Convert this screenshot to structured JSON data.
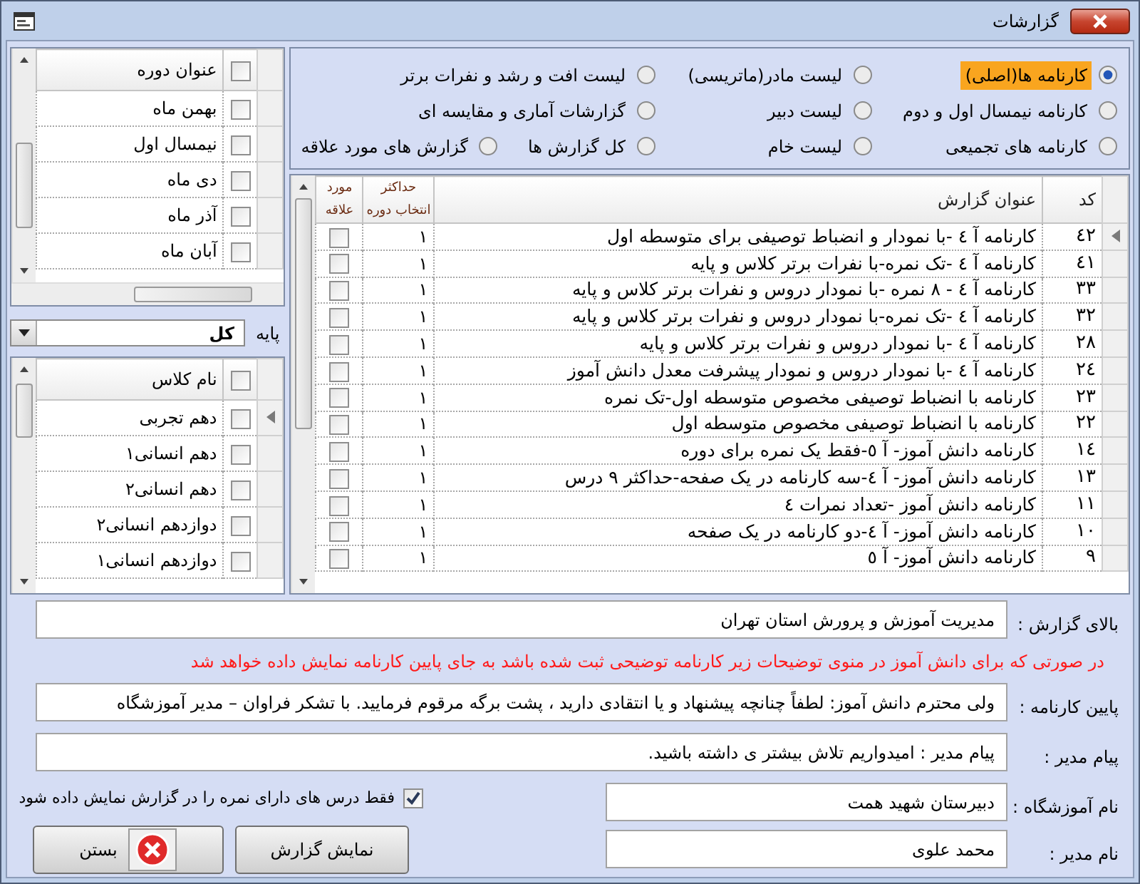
{
  "window": {
    "title": "گزارشات"
  },
  "report_type_rows": [
    {
      "options": [
        {
          "label": "کارنامه ها(اصلی)",
          "selected": true
        },
        {
          "label": "لیست مادر(ماتریسی)",
          "selected": false
        },
        {
          "label": "لیست افت و رشد و نفرات برتر",
          "selected": false
        }
      ]
    },
    {
      "options": [
        {
          "label": "کارنامه نیمسال اول و دوم",
          "selected": false
        },
        {
          "label": "لیست دبیر",
          "selected": false
        },
        {
          "label": "گزارشات آماری و مقایسه ای",
          "selected": false
        }
      ]
    },
    {
      "options": [
        {
          "label": "کارنامه های تجمیعی",
          "selected": false
        },
        {
          "label": "لیست خام",
          "selected": false
        },
        {
          "label": "کل گزارش ها",
          "selected": false
        },
        {
          "label": "گزارش های مورد علاقه",
          "selected": false
        }
      ]
    }
  ],
  "reports": {
    "columns": [
      "کد",
      "عنوان گزارش",
      "حداکثر انتخاب دوره",
      "مورد علاقه"
    ],
    "rows": [
      {
        "code": "٤٢",
        "title": "کارنامه آ ٤ -با نمودار و انضباط توصیفی برای متوسطه اول",
        "max": "١",
        "favorite": false,
        "current": true
      },
      {
        "code": "٤١",
        "title": "کارنامه آ ٤ -تک نمره-با نفرات برتر کلاس و پایه",
        "max": "١",
        "favorite": false,
        "current": false
      },
      {
        "code": "٣٣",
        "title": "کارنامه آ ٤ - ٨  نمره  -با نمودار دروس و نفرات برتر کلاس و پایه",
        "max": "١",
        "favorite": false,
        "current": false
      },
      {
        "code": "٣٢",
        "title": "کارنامه آ ٤ -تک نمره-با نمودار دروس و نفرات برتر کلاس و پایه",
        "max": "١",
        "favorite": false,
        "current": false
      },
      {
        "code": "٢٨",
        "title": "کارنامه آ ٤ -با نمودار دروس و نفرات برتر کلاس و پایه",
        "max": "١",
        "favorite": false,
        "current": false
      },
      {
        "code": "٢٤",
        "title": "کارنامه آ ٤ -با نمودار دروس و نمودار پیشرفت معدل دانش آموز",
        "max": "١",
        "favorite": false,
        "current": false
      },
      {
        "code": "٢٣",
        "title": "کارنامه با انضباط توصیفی مخصوص متوسطه اول-تک نمره",
        "max": "١",
        "favorite": false,
        "current": false
      },
      {
        "code": "٢٢",
        "title": "کارنامه با انضباط توصیفی مخصوص متوسطه اول",
        "max": "١",
        "favorite": false,
        "current": false
      },
      {
        "code": "١٤",
        "title": "کارنامه دانش آموز- آ ٥-فقط یک نمره برای دوره",
        "max": "١",
        "favorite": false,
        "current": false
      },
      {
        "code": "١٣",
        "title": "کارنامه دانش آموز- آ ٤-سه کارنامه در یک صفحه-حداکثر ٩ درس",
        "max": "١",
        "favorite": false,
        "current": false
      },
      {
        "code": "١١",
        "title": "کارنامه دانش آموز -تعداد نمرات ٤",
        "max": "١",
        "favorite": false,
        "current": false
      },
      {
        "code": "١٠",
        "title": "کارنامه دانش آموز- آ ٤-دو کارنامه در یک صفحه",
        "max": "١",
        "favorite": false,
        "current": false
      },
      {
        "code": "٩",
        "title": "کارنامه دانش آموز- آ ٥",
        "max": "١",
        "favorite": false,
        "current": false
      }
    ]
  },
  "periods": {
    "header": "عنوان دوره",
    "header_checked": false,
    "rows": [
      {
        "label": "بهمن ماه",
        "checked": false,
        "current": false
      },
      {
        "label": "نیمسال  اول",
        "checked": false,
        "current": false
      },
      {
        "label": "دی ماه",
        "checked": false,
        "current": false
      },
      {
        "label": "آذر ماه",
        "checked": false,
        "current": false
      },
      {
        "label": "آبان ماه",
        "checked": false,
        "current": false
      }
    ]
  },
  "grade": {
    "label": "پایه",
    "value": "کل"
  },
  "classes": {
    "header": "نام کلاس",
    "header_checked": false,
    "rows": [
      {
        "label": "دهم تجربی",
        "checked": false,
        "current": true
      },
      {
        "label": "دهم انسانی۱",
        "checked": false,
        "current": false
      },
      {
        "label": "دهم انسانی۲",
        "checked": false,
        "current": false
      },
      {
        "label": "دوازدهم انسانی۲",
        "checked": false,
        "current": false
      },
      {
        "label": "دوازدهم انسانی۱",
        "checked": false,
        "current": false
      }
    ]
  },
  "report_header": {
    "label": "بالای گزارش :",
    "value": "مدیریت آموزش و پرورش استان تهران"
  },
  "note": "در صورتی که برای دانش آموز در منوی توضیحات زیر کارنامه توضیحی ثبت شده باشد به جای پایین کارنامه نمایش داده خواهد شد",
  "report_footer": {
    "label": "پایین کارنامه :",
    "value": "ولی محترم دانش آموز: لطفاً چنانچه پیشنهاد و یا انتقادی دارید ، پشت برگه مرقوم فرمایید. با تشکر فراوان – مدیر آموزشگاه"
  },
  "principal_message": {
    "label": "پیام مدیر :",
    "value": "پیام مدیر : امیدواریم تلاش بیشتر ی داشته باشید."
  },
  "school_name": {
    "label": "نام آموزشگاه :",
    "value": "دبیرستان شهید همت"
  },
  "only_graded": {
    "label": "فقط درس های دارای نمره را  در گزارش نمایش داده شود",
    "checked": true
  },
  "principal_name": {
    "label": "نام مدیر :",
    "value": "محمد علوی"
  },
  "buttons": [
    {
      "label": "نمایش گزارش",
      "kind": "show"
    },
    {
      "label": "بستن",
      "kind": "close"
    }
  ]
}
